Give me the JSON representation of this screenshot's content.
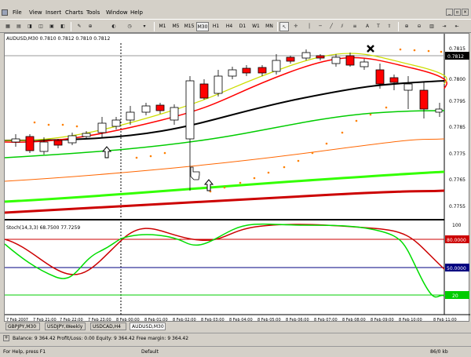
{
  "menu": [
    "File",
    "View",
    "Insert",
    "Charts",
    "Tools",
    "Window",
    "Help"
  ],
  "toolbar": {
    "timeframes": [
      "M1",
      "M5",
      "M15",
      "M30",
      "H1",
      "H4",
      "D1",
      "W1",
      "MN"
    ],
    "selected_timeframe": "M30"
  },
  "chart": {
    "header": "AUDUSD,M30  0.7810 0.7812 0.7810 0.7812",
    "current_price": "0.7812",
    "price_labels": [
      "0.7815",
      "0.7812",
      "0.7800",
      "0.7795",
      "0.7785",
      "0.7775",
      "0.7765",
      "0.7755"
    ],
    "time_labels": [
      "7 Feb 2007",
      "7 Feb 21:00",
      "7 Feb 22:00",
      "7 Feb 23:00",
      "8 Feb 00:00",
      "8 Feb 01:00",
      "8 Feb 02:00",
      "8 Feb 03:00",
      "8 Feb 04:00",
      "8 Feb 05:00",
      "8 Feb 06:00",
      "8 Feb 07:00",
      "8 Feb 08:00",
      "8 Feb 09:00",
      "8 Feb 10:00",
      "8 Feb 11:00"
    ],
    "colors": {
      "bull": "#ffffff",
      "bear": "#ff0000",
      "ema_fast": "#ff0000",
      "ema_slow": "#000000",
      "ema_long": "#00cc00",
      "envelope": "#ff6600",
      "band_green": "#33ff00",
      "band_red": "#cc0000",
      "psar": "#ff8000"
    }
  },
  "stoch": {
    "header": "Stoch(14,3,3) 68.7500 77.7259",
    "levels": [
      "100",
      "80.0000",
      "50.0000",
      "20"
    ],
    "colors": {
      "main": "#00dd00",
      "signal": "#cc0000",
      "upper": "#cc0000",
      "mid": "#000080",
      "lower": "#00cc00"
    }
  },
  "tabs": [
    "GBPJPY,M30",
    "USDJPY,Weekly",
    "USDCAD,H4",
    "AUDUSD,M30"
  ],
  "active_tab": "AUDUSD,M30",
  "account": "Balance: 9 364.42  Profit/Loss: 0.00  Equity: 9 364.42  Free margin: 9 364.42",
  "status": {
    "help": "For Help, press F1",
    "profile": "Default",
    "traffic": "86/0 kb"
  }
}
